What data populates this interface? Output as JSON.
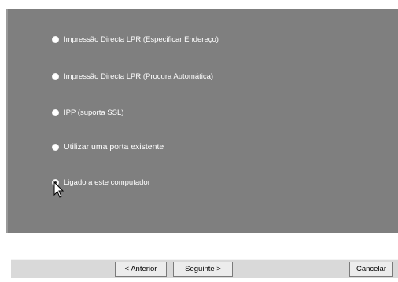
{
  "options": [
    {
      "label": "Impressão Directa LPR (Especificar Endereço)",
      "selected": false
    },
    {
      "label": "Impressão Directa LPR (Procura Automática)",
      "selected": false
    },
    {
      "label": "IPP (suporta SSL)",
      "selected": false
    },
    {
      "label": "Utilizar uma porta existente",
      "selected": false
    },
    {
      "label": "Ligado a este computador",
      "selected": true
    }
  ],
  "buttons": {
    "back": "< Anterior",
    "next": "Seguinte >",
    "cancel": "Cancelar"
  },
  "colors": {
    "panel": "#7f7f7f",
    "bar": "#d9d9d9"
  }
}
